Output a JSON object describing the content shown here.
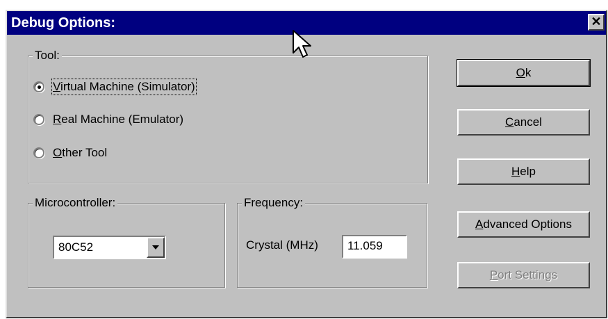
{
  "dialog": {
    "title": "Debug Options:",
    "close_glyph": "✕"
  },
  "tool_group": {
    "title": "Tool:",
    "options": [
      {
        "hotkey": "V",
        "rest": "irtual Machine (Simulator)",
        "selected": true
      },
      {
        "hotkey": "R",
        "rest": "eal Machine (Emulator)",
        "selected": false
      },
      {
        "hotkey": "O",
        "rest": "ther Tool",
        "selected": false
      }
    ]
  },
  "micro_group": {
    "title": "Microcontroller:",
    "selected_value": "80C52"
  },
  "freq_group": {
    "title": "Frequency:",
    "crystal_label": "Crystal (MHz)",
    "crystal_value": "11.059"
  },
  "buttons": {
    "ok": {
      "hotkey": "O",
      "rest": "k"
    },
    "cancel": {
      "hotkey": "C",
      "rest": "ancel"
    },
    "help": {
      "hotkey": "H",
      "rest": "elp"
    },
    "advanced": {
      "hotkey": "A",
      "rest": "dvanced Options"
    },
    "port": {
      "hotkey": "P",
      "rest": "ort Settings",
      "disabled": true
    }
  },
  "icons": {
    "close": "close-icon",
    "dropdown": "chevron-down-icon",
    "cursor": "mouse-pointer-icon"
  },
  "colors": {
    "titlebar": "#000080",
    "face": "#c0c0c0"
  }
}
